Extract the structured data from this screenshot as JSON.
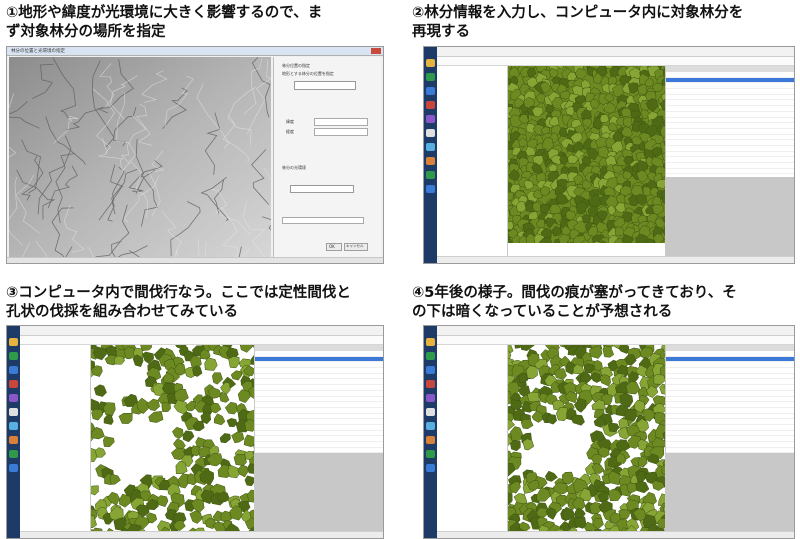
{
  "captions": {
    "panel1": [
      "①地形や緯度が光環境に大きく影響するので、ま",
      "ず対象林分の場所を指定"
    ],
    "panel2": [
      "②林分情報を入力し、コンピュータ内に対象林分を",
      "再現する"
    ],
    "panel3": [
      "③コンピュータ内で間伐行なう。ここでは定性間伐と",
      "孔状の伐採を組み合わせてみている"
    ],
    "panel4": [
      "④5年後の様子。間伐の痕が塞がってきており、そ",
      "の下は暗くなっていることが予想される"
    ]
  },
  "colors": {
    "canopy": "#6d8a22",
    "canopy_dark": "#4f6a14",
    "canopy_light": "#86a535",
    "taskbar": "#1d3b66",
    "selection": "#3b78d8"
  },
  "map_dialog": {
    "title": "林分の位置と光環境の指定",
    "labels": [
      "林分位置の指定",
      "地形とする林分の位置を指定",
      "緯度",
      "経度",
      "林分の光環境",
      "選択"
    ],
    "buttons": [
      "OK",
      "キャンセル"
    ]
  },
  "icons": [
    "folder-icon",
    "gear-icon",
    "chart-icon",
    "tree-icon",
    "save-icon",
    "settings-icon"
  ]
}
